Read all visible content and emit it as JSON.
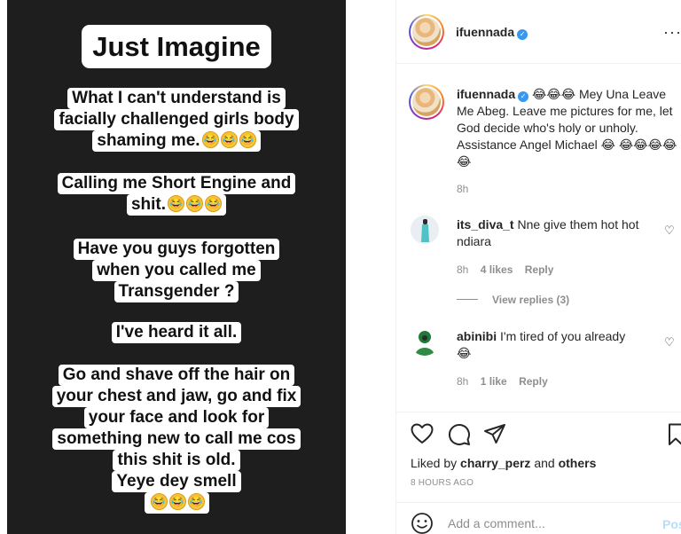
{
  "story": {
    "title": "Just Imagine",
    "paragraphs": [
      [
        "What I can't understand is",
        "facially challenged girls body",
        "shaming me."
      ],
      [
        "Calling me Short Engine and",
        "shit."
      ],
      [
        "Have you guys forgotten",
        "when you called me",
        "Transgender ?"
      ],
      [
        "I've heard it all."
      ],
      [
        "Go and shave off the hair on",
        "your chest and jaw, go and fix",
        "your face and look for",
        "something new to call me cos",
        "this shit is old.",
        "Yeye dey smell"
      ]
    ],
    "laugh_emoji": "😂"
  },
  "header": {
    "username": "ifuennada",
    "more": "···"
  },
  "caption": {
    "username": "ifuennada",
    "emojis_lead": "😂😂😂",
    "text": "Mey Una Leave Me Abeg. Leave me pictures for me, let God decide who's holy or unholy. Assistance Angel Michael",
    "emojis_tail": "😂",
    "emojis_line": "😂😂😂😂😂",
    "time": "8h"
  },
  "comments": [
    {
      "username": "its_diva_t",
      "text": "Nne give them hot hot ndiara",
      "time": "8h",
      "likes": "4 likes",
      "reply": "Reply",
      "view_replies": "View replies (3)"
    },
    {
      "username": "abinibi",
      "text": "I'm tired of you already",
      "emoji": "😂",
      "time": "8h",
      "likes": "1 like",
      "reply": "Reply"
    }
  ],
  "actions": {
    "liked_prefix": "Liked by",
    "liked_user": "charry_perz",
    "liked_and": "and",
    "liked_others": "others",
    "time_ago": "8 HOURS AGO"
  },
  "add_comment": {
    "placeholder": "Add a comment...",
    "post": "Post"
  },
  "colors": {
    "accent": "#3897f0",
    "post_disabled": "#b2dffc",
    "muted": "#8e8e8e",
    "story_bg": "#1e1e1e"
  }
}
